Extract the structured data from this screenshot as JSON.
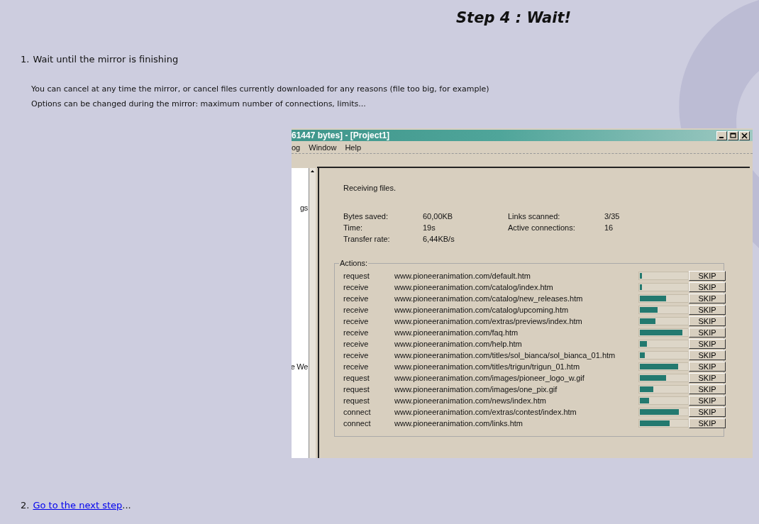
{
  "title": "Step 4 : Wait!",
  "steps": [
    {
      "number": "1.",
      "text": "Wait until the mirror is finishing"
    }
  ],
  "notes": [
    "You can cancel at any time the mirror, or cancel files currently downloaded for any reasons (file too big, for example)",
    "Options can be changed during the mirror: maximum number of connections, limits..."
  ],
  "screenshot": {
    "window_title": "61447 bytes] - [Project1]",
    "menu": [
      "og",
      "Window",
      "Help"
    ],
    "left_pane": [
      "gs",
      "e We"
    ],
    "status": "Receiving files.",
    "stats": [
      {
        "label": "Bytes saved:",
        "value": "60,00KB"
      },
      {
        "label": "Links scanned:",
        "value": "3/35"
      },
      {
        "label": "Time:",
        "value": "19s"
      },
      {
        "label": "Active connections:",
        "value": "16"
      },
      {
        "label": "Transfer rate:",
        "value": "6,44KB/s"
      }
    ],
    "actions_label": "Actions:",
    "actions": [
      {
        "action": "request",
        "url": "www.pioneeranimation.com/default.htm",
        "level": 0.05,
        "button": "SKIP"
      },
      {
        "action": "receive",
        "url": "www.pioneeranimation.com/catalog/index.htm",
        "level": 0.05,
        "button": "SKIP"
      },
      {
        "action": "receive",
        "url": "www.pioneeranimation.com/catalog/new_releases.htm",
        "level": 0.55,
        "button": "SKIP"
      },
      {
        "action": "receive",
        "url": "www.pioneeranimation.com/catalog/upcoming.htm",
        "level": 0.38,
        "button": "SKIP"
      },
      {
        "action": "receive",
        "url": "www.pioneeranimation.com/extras/previews/index.htm",
        "level": 0.33,
        "button": "SKIP"
      },
      {
        "action": "receive",
        "url": "www.pioneeranimation.com/faq.htm",
        "level": 0.9,
        "button": "SKIP"
      },
      {
        "action": "receive",
        "url": "www.pioneeranimation.com/help.htm",
        "level": 0.15,
        "button": "SKIP"
      },
      {
        "action": "receive",
        "url": "www.pioneeranimation.com/titles/sol_bianca/sol_bianca_01.htm",
        "level": 0.1,
        "button": "SKIP"
      },
      {
        "action": "receive",
        "url": "www.pioneeranimation.com/titles/trigun/trigun_01.htm",
        "level": 0.8,
        "button": "SKIP"
      },
      {
        "action": "request",
        "url": "www.pioneeranimation.com/images/pioneer_logo_w.gif",
        "level": 0.55,
        "button": "SKIP"
      },
      {
        "action": "request",
        "url": "www.pioneeranimation.com/images/one_pix.gif",
        "level": 0.28,
        "button": "SKIP"
      },
      {
        "action": "request",
        "url": "www.pioneeranimation.com/news/index.htm",
        "level": 0.2,
        "button": "SKIP"
      },
      {
        "action": "connect",
        "url": "www.pioneeranimation.com/extras/contest/index.htm",
        "level": 0.82,
        "button": "SKIP"
      },
      {
        "action": "connect",
        "url": "www.pioneeranimation.com/links.htm",
        "level": 0.62,
        "button": "SKIP"
      }
    ]
  },
  "next": {
    "number": "2.",
    "link": "Go to the next step",
    "suffix": "..."
  }
}
